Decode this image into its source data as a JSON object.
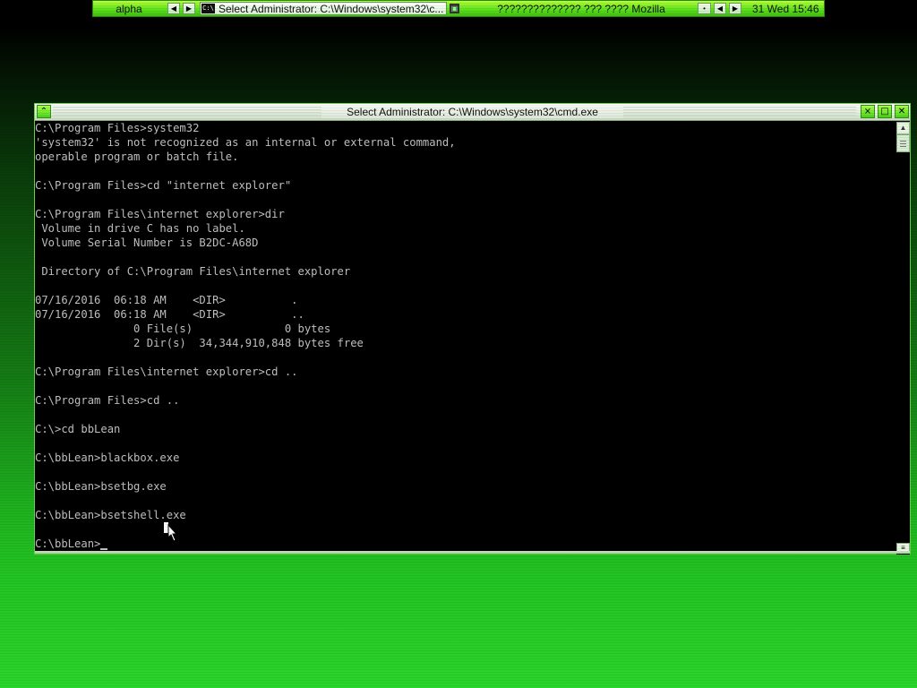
{
  "taskbar": {
    "workspace": "alpha",
    "prev_icon": "◀",
    "next_icon": "▶",
    "active_task": "Select Administrator: C:\\Windows\\system32\\c...",
    "active_task_icon": "cmd-icon",
    "other_task": "?????????????? ??? ???? Mozilla",
    "clock": "31 Wed 15:46"
  },
  "window": {
    "title": "Select Administrator: C:\\Windows\\system32\\cmd.exe",
    "accent": "#5fd82a"
  },
  "console": {
    "text_color": "#c0c0c0",
    "background": "#000000",
    "lines": [
      "C:\\Program Files>system32",
      "'system32' is not recognized as an internal or external command,",
      "operable program or batch file.",
      "",
      "C:\\Program Files>cd \"internet explorer\"",
      "",
      "C:\\Program Files\\internet explorer>dir",
      " Volume in drive C has no label.",
      " Volume Serial Number is B2DC-A68D",
      "",
      " Directory of C:\\Program Files\\internet explorer",
      "",
      "07/16/2016  06:18 AM    <DIR>          .",
      "07/16/2016  06:18 AM    <DIR>          ..",
      "               0 File(s)              0 bytes",
      "               2 Dir(s)  34,344,910,848 bytes free",
      "",
      "C:\\Program Files\\internet explorer>cd ..",
      "",
      "C:\\Program Files>cd ..",
      "",
      "C:\\>cd bbLean",
      "",
      "C:\\bbLean>blackbox.exe",
      "",
      "C:\\bbLean>bsetbg.exe",
      "",
      "C:\\bbLean>bsetshell.exe",
      ""
    ],
    "prompt": "C:\\bbLean>"
  }
}
